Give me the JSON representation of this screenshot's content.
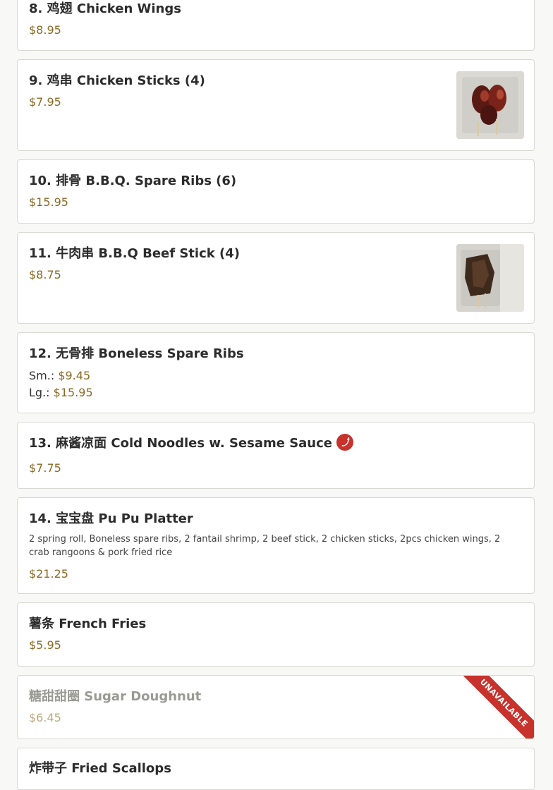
{
  "menu": {
    "items": [
      {
        "title": "8. 鸡翅 Chicken Wings",
        "price": "$8.95"
      },
      {
        "title": "9. 鸡串 Chicken Sticks (4)",
        "price": "$7.95",
        "image": "chicken-sticks-photo"
      },
      {
        "title": "10. 排骨 B.B.Q. Spare Ribs (6)",
        "price": "$15.95"
      },
      {
        "title": "11. 牛肉串 B.B.Q Beef Stick (4)",
        "price": "$8.75",
        "image": "beef-stick-photo"
      },
      {
        "title": "12. 无骨排 Boneless Spare Ribs",
        "sizes": [
          {
            "label": "Sm.:",
            "price": "$9.45"
          },
          {
            "label": "Lg.:",
            "price": "$15.95"
          }
        ]
      },
      {
        "title": "13. 麻酱凉面 Cold Noodles w. Sesame Sauce",
        "price": "$7.75",
        "badge_icon": "spicy-pepper-icon"
      },
      {
        "title": "14. 宝宝盘 Pu Pu Platter",
        "description": "2 spring roll, Boneless spare ribs, 2 fantail shrimp, 2 beef stick, 2 chicken sticks, 2pcs chicken wings, 2 crab rangoons & pork fried rice",
        "price": "$21.25"
      },
      {
        "title": "薯条 French Fries",
        "price": "$5.95"
      },
      {
        "title": "糖甜甜圈 Sugar Doughnut",
        "price": "$6.45",
        "ribbon": "UNAVAILABLE"
      },
      {
        "title": "炸带子 Fried Scallops"
      }
    ]
  },
  "colors": {
    "price": "#8a6a25",
    "title": "#2c2c2c",
    "accent_red": "#c8322c",
    "card_border": "#d9d9d4",
    "background": "#f8f8f6"
  }
}
